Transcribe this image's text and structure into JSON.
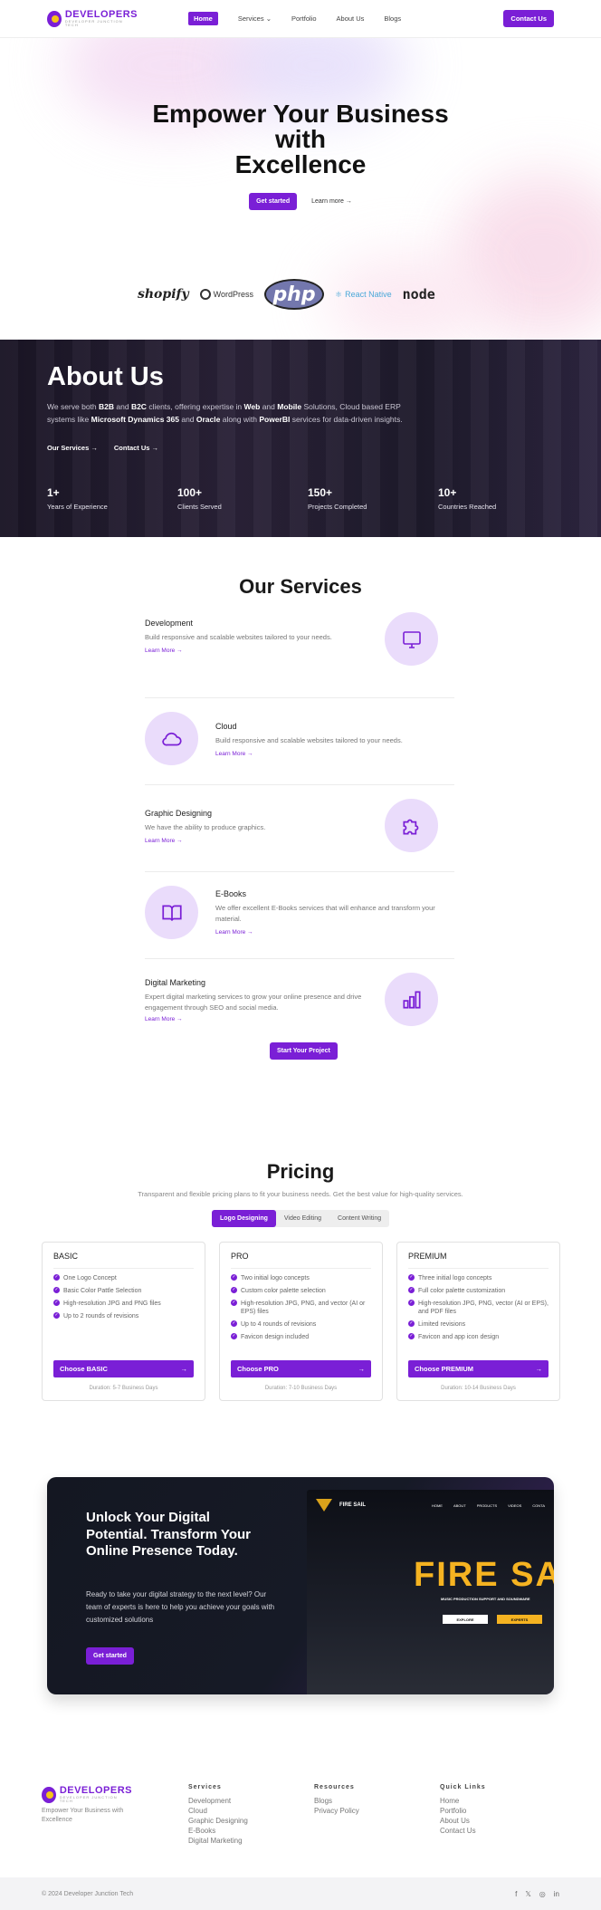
{
  "nav": {
    "logo_text": "DEVELOPERS",
    "logo_sub": "DEVELOPER JUNCTION TECH",
    "links": [
      "Home",
      "Services",
      "Portfolio",
      "About Us",
      "Blogs"
    ],
    "cta": "Contact Us"
  },
  "hero": {
    "title_line1": "Empower Your Business",
    "title_line2": "with",
    "title_line3": "Excellence",
    "primary": "Get started",
    "secondary": "Learn more →",
    "tech_logos": [
      "shopify",
      "WordPress",
      "php",
      "React Native",
      "node"
    ]
  },
  "about": {
    "title": "About Us",
    "text_parts": [
      "We serve both ",
      "B2B",
      " and ",
      "B2C",
      " clients, offering expertise in ",
      "Web",
      " and ",
      "Mobile",
      " Solutions, Cloud based ERP systems like ",
      "Microsoft Dynamics 365",
      " and ",
      "Oracle",
      " along with ",
      "PowerBI",
      " services for data-driven insights."
    ],
    "link1": "Our Services →",
    "link2": "Contact Us →",
    "stats": [
      {
        "value": "1+",
        "label": "Years of Experience"
      },
      {
        "value": "100+",
        "label": "Clients Served"
      },
      {
        "value": "150+",
        "label": "Projects Completed"
      },
      {
        "value": "10+",
        "label": "Countries Reached"
      }
    ]
  },
  "services": {
    "title": "Our Services",
    "items": [
      {
        "title": "Development",
        "desc": "Build responsive and scalable websites tailored to your needs.",
        "more": "Learn More →",
        "icon": "monitor-icon"
      },
      {
        "title": "Cloud",
        "desc": "Build responsive and scalable websites tailored to your needs.",
        "more": "Learn More →",
        "icon": "cloud-icon"
      },
      {
        "title": "Graphic Designing",
        "desc": "We have the ability to produce graphics.",
        "more": "Learn More →",
        "icon": "puzzle-icon"
      },
      {
        "title": "E-Books",
        "desc": "We offer excellent E-Books services that will enhance and transform your material.",
        "more": "Learn More →",
        "icon": "book-icon"
      },
      {
        "title": "Digital Marketing",
        "desc": "Expert digital marketing services to grow your online presence and drive engagement through SEO and social media.",
        "more": "Learn More →",
        "icon": "bar-chart-icon"
      }
    ],
    "cta": "Start Your Project"
  },
  "pricing": {
    "title": "Pricing",
    "subtitle": "Transparent and flexible pricing plans to fit your business needs. Get the best value for high-quality services.",
    "tabs": [
      "Logo Designing",
      "Video Editing",
      "Content Writing"
    ],
    "plans": [
      {
        "name": "BASIC",
        "features": [
          "One Logo Concept",
          "Basic Color Pattle Selection",
          "High-resolution JPG and PNG files",
          "Up to 2 rounds of revisions"
        ],
        "button": "Choose BASIC",
        "duration": "Duration: 5-7 Business Days"
      },
      {
        "name": "PRO",
        "features": [
          "Two initial logo concepts",
          "Custom color palette selection",
          "High-resolution JPG, PNG, and vector (AI or EPS) files",
          "Up to 4 rounds of revisions",
          "Favicon design included"
        ],
        "button": "Choose PRO",
        "duration": "Duration: 7-10 Business Days"
      },
      {
        "name": "PREMIUM",
        "features": [
          "Three initial logo concepts",
          "Full color palette customization",
          "High-resolution JPG, PNG, vector (AI or EPS), and PDF files",
          "Limited revisions",
          "Favicon and app icon design"
        ],
        "button": "Choose PREMIUM",
        "duration": "Duration: 10-14 Business Days"
      }
    ],
    "arrow": "→"
  },
  "cta": {
    "title": "Unlock Your Digital Potential. Transform Your Online Presence Today.",
    "text": "Ready to take your digital strategy to the next level? Our team of experts is here to help you achieve your goals with customized solutions",
    "button": "Get started",
    "preview": {
      "brand": "FIRE SAIL",
      "links": [
        "HOME",
        "ABOUT",
        "PRODUCTS",
        "VIDEOS",
        "CONTA"
      ],
      "headline": "FIRE SA",
      "tagline": "MUSIC PRODUCTION SUPPORT AND SOUNDWARE",
      "btn1": "EXPLORE",
      "btn2": "EXPERTS"
    }
  },
  "footer": {
    "tagline": "Empower Your Business with Excellence",
    "columns": [
      {
        "title": "Services",
        "items": [
          "Development",
          "Cloud",
          "Graphic Designing",
          "E-Books",
          "Digital Marketing"
        ]
      },
      {
        "title": "Resources",
        "items": [
          "Blogs",
          "Privacy Policy"
        ]
      },
      {
        "title": "Quick Links",
        "items": [
          "Home",
          "Portfolio",
          "About Us",
          "Contact Us"
        ]
      }
    ],
    "copyright": "© 2024 Developer Junction Tech",
    "socials": [
      "f",
      "𝕏",
      "◎",
      "in"
    ]
  },
  "colors": {
    "accent": "#7a1fd6",
    "dark": "#141722",
    "circle": "#eadcfb"
  }
}
